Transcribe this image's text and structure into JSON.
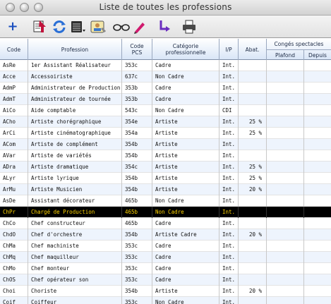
{
  "window": {
    "title": "Liste de toutes les professions"
  },
  "toolbar": {
    "buttons": [
      {
        "name": "add",
        "glyph": "+"
      },
      {
        "name": "import",
        "glyph": ""
      },
      {
        "name": "refresh",
        "glyph": ""
      },
      {
        "name": "list-options",
        "glyph": ""
      },
      {
        "name": "profile",
        "glyph": ""
      },
      {
        "name": "glasses",
        "glyph": ""
      },
      {
        "name": "edit",
        "glyph": ""
      },
      {
        "name": "export",
        "glyph": ""
      },
      {
        "name": "print",
        "glyph": ""
      }
    ]
  },
  "table": {
    "headers": {
      "code": "Code",
      "profession": "Profession",
      "pcs": "Code PCS",
      "categorie": "Catégorie professionnelle",
      "ip": "I/P",
      "abat": "Abat.",
      "conges": "Congés spectacles",
      "plafond": "Plafond",
      "depuis": "Depuis"
    },
    "rows": [
      {
        "code": "AsRe",
        "profession": "1er Assistant Réalisateur",
        "pcs": "353c",
        "cat": "Cadre",
        "ip": "Int.",
        "abat": ""
      },
      {
        "code": "Acce",
        "profession": "Accessoiriste",
        "pcs": "637c",
        "cat": "Non Cadre",
        "ip": "Int.",
        "abat": ""
      },
      {
        "code": "AdmP",
        "profession": "Administrateur de Production",
        "pcs": "353b",
        "cat": "Cadre",
        "ip": "Int.",
        "abat": ""
      },
      {
        "code": "AdmT",
        "profession": "Administrateur de tournée",
        "pcs": "353b",
        "cat": "Cadre",
        "ip": "Int.",
        "abat": ""
      },
      {
        "code": "AiCo",
        "profession": "Aide comptable",
        "pcs": "543c",
        "cat": "Non Cadre",
        "ip": "CDI",
        "abat": ""
      },
      {
        "code": "ACho",
        "profession": "Artiste chorégraphique",
        "pcs": "354e",
        "cat": "Artiste",
        "ip": "Int.",
        "abat": "25 %"
      },
      {
        "code": "ArCi",
        "profession": "Artiste cinématographique",
        "pcs": "354a",
        "cat": "Artiste",
        "ip": "Int.",
        "abat": "25 %"
      },
      {
        "code": "ACom",
        "profession": "Artiste de complément",
        "pcs": "354b",
        "cat": "Artiste",
        "ip": "Int.",
        "abat": ""
      },
      {
        "code": "AVar",
        "profession": "Artiste de variétés",
        "pcs": "354b",
        "cat": "Artiste",
        "ip": "Int.",
        "abat": ""
      },
      {
        "code": "ADra",
        "profession": "Artiste dramatique",
        "pcs": "354c",
        "cat": "Artiste",
        "ip": "Int.",
        "abat": "25 %"
      },
      {
        "code": "ALyr",
        "profession": "Artiste lyrique",
        "pcs": "354b",
        "cat": "Artiste",
        "ip": "Int.",
        "abat": "25 %"
      },
      {
        "code": "ArMu",
        "profession": "Artiste Musicien",
        "pcs": "354b",
        "cat": "Artiste",
        "ip": "Int.",
        "abat": "20 %"
      },
      {
        "code": "AsDe",
        "profession": "Assistant décorateur",
        "pcs": "465b",
        "cat": "Non Cadre",
        "ip": "Int.",
        "abat": ""
      },
      {
        "code": "ChPr",
        "profession": "Chargé de Production",
        "pcs": "465b",
        "cat": "Non Cadre",
        "ip": "Int.",
        "abat": "",
        "selected": true
      },
      {
        "code": "ChCo",
        "profession": "Chef constructeur",
        "pcs": "465b",
        "cat": "Cadre",
        "ip": "Int.",
        "abat": ""
      },
      {
        "code": "ChdO",
        "profession": "Chef d'orchestre",
        "pcs": "354b",
        "cat": "Artiste Cadre",
        "ip": "Int.",
        "abat": "20 %"
      },
      {
        "code": "ChMa",
        "profession": "Chef machiniste",
        "pcs": "353c",
        "cat": "Cadre",
        "ip": "Int.",
        "abat": ""
      },
      {
        "code": "ChMq",
        "profession": "Chef maquilleur",
        "pcs": "353c",
        "cat": "Cadre",
        "ip": "Int.",
        "abat": ""
      },
      {
        "code": "ChMo",
        "profession": "Chef monteur",
        "pcs": "353c",
        "cat": "Cadre",
        "ip": "Int.",
        "abat": ""
      },
      {
        "code": "ChOS",
        "profession": "Chef opérateur son",
        "pcs": "353c",
        "cat": "Cadre",
        "ip": "Int.",
        "abat": ""
      },
      {
        "code": "Choi",
        "profession": "Choriste",
        "pcs": "354b",
        "cat": "Artiste",
        "ip": "Int.",
        "abat": "20 %"
      },
      {
        "code": "Coif",
        "profession": "Coiffeur",
        "pcs": "353c",
        "cat": "Non Cadre",
        "ip": "Int.",
        "abat": ""
      }
    ]
  },
  "colors": {
    "selection_bg": "#000000",
    "selection_text": "#ffd400",
    "alt_row": "#eef4fd"
  }
}
